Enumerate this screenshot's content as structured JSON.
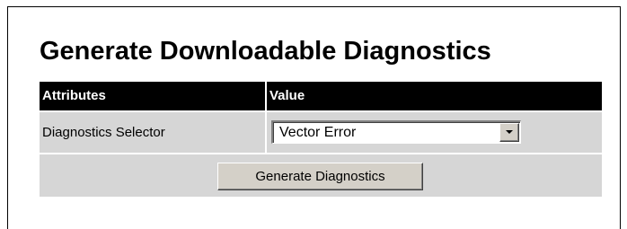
{
  "page": {
    "title": "Generate Downloadable Diagnostics"
  },
  "table": {
    "headers": {
      "attributes": "Attributes",
      "value": "Value"
    },
    "rows": [
      {
        "attribute": "Diagnostics Selector",
        "selected_value": "Vector Error"
      }
    ]
  },
  "actions": {
    "generate_label": "Generate Diagnostics"
  },
  "colors": {
    "header_background": "#000000",
    "header_text": "#ffffff",
    "row_background": "#d6d6d6",
    "button_face": "#d4d0c8"
  }
}
